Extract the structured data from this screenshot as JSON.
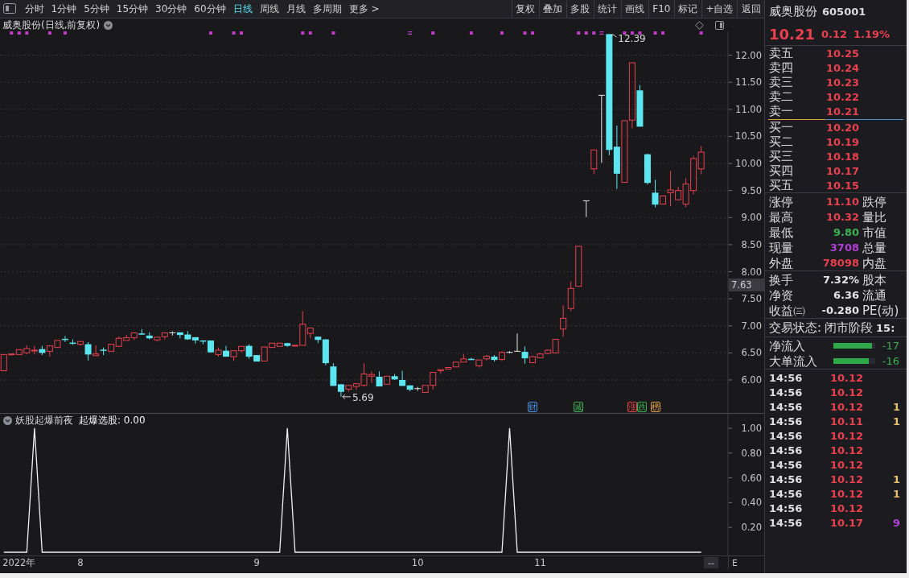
{
  "toolbar": {
    "period_tabs": [
      {
        "label": "分时",
        "selected": false
      },
      {
        "label": "1分钟",
        "selected": false
      },
      {
        "label": "5分钟",
        "selected": false
      },
      {
        "label": "15分钟",
        "selected": false
      },
      {
        "label": "30分钟",
        "selected": false
      },
      {
        "label": "60分钟",
        "selected": false
      },
      {
        "label": "日线",
        "selected": true
      },
      {
        "label": "周线",
        "selected": false
      },
      {
        "label": "月线",
        "selected": false
      },
      {
        "label": "多周期",
        "selected": false
      },
      {
        "label": "更多 >",
        "selected": false
      }
    ],
    "buttons": [
      "复权",
      "叠加",
      "多股",
      "统计",
      "画线",
      "F10",
      "标记",
      "+自选",
      "返回"
    ]
  },
  "chart_header": {
    "title": "威奥股份(日线,前复权)"
  },
  "main_chart": {
    "chart_data": [
      {
        "type": "candlestick",
        "ylim": [
          5.39,
          12.44
        ],
        "yticks": [
          {
            "value": 6,
            "label": "6.00"
          },
          {
            "value": 6.5,
            "label": "6.50"
          },
          {
            "value": 7,
            "label": "7.00"
          },
          {
            "value": 7.5,
            "label": "7.50"
          },
          {
            "value": 8,
            "label": "8.00"
          },
          {
            "value": 8.5,
            "label": "8.50"
          },
          {
            "value": 9,
            "label": "9.00"
          },
          {
            "value": 9.5,
            "label": "9.50"
          },
          {
            "value": 10,
            "label": "10.00"
          },
          {
            "value": 10.5,
            "label": "10.50"
          },
          {
            "value": 11,
            "label": "11.00"
          },
          {
            "value": 11.5,
            "label": "11.50"
          },
          {
            "value": 12,
            "label": "12.00"
          }
        ],
        "grid": true,
        "annotations": [
          "12.39",
          "5.69"
        ],
        "series": [
          {
            "type": "candlestick",
            "ohlc": [
              [
                6.17,
                6.47,
                6.17,
                6.47
              ],
              [
                6.47,
                6.49,
                6.46,
                6.48
              ],
              [
                6.47,
                6.56,
                6.47,
                6.56
              ],
              [
                6.5,
                6.64,
                6.47,
                6.58
              ],
              [
                6.54,
                6.63,
                6.47,
                6.55
              ],
              [
                6.57,
                6.63,
                6.46,
                6.5
              ],
              [
                6.53,
                6.63,
                6.43,
                6.63
              ],
              [
                6.6,
                6.73,
                6.6,
                6.73
              ],
              [
                6.76,
                6.81,
                6.7,
                6.75
              ],
              [
                6.69,
                6.75,
                6.65,
                6.68
              ],
              [
                6.66,
                6.71,
                6.63,
                6.71
              ],
              [
                6.66,
                6.7,
                6.36,
                6.47
              ],
              [
                6.45,
                6.64,
                6.44,
                6.48
              ],
              [
                6.56,
                6.6,
                6.46,
                6.55
              ],
              [
                6.53,
                6.66,
                6.53,
                6.66
              ],
              [
                6.62,
                6.8,
                6.62,
                6.77
              ],
              [
                6.73,
                6.83,
                6.73,
                6.78
              ],
              [
                6.78,
                6.87,
                6.74,
                6.87
              ],
              [
                6.86,
                6.94,
                6.83,
                6.85
              ],
              [
                6.82,
                6.88,
                6.75,
                6.77
              ],
              [
                6.74,
                6.79,
                6.71,
                6.79
              ],
              [
                6.8,
                6.87,
                6.75,
                6.87
              ],
              [
                6.87,
                6.9,
                6.82,
                6.87
              ],
              [
                6.88,
                6.88,
                6.77,
                6.83
              ],
              [
                6.84,
                6.9,
                6.74,
                6.75
              ],
              [
                6.79,
                6.79,
                6.67,
                6.73
              ],
              [
                6.73,
                6.73,
                6.66,
                6.72
              ],
              [
                6.73,
                6.73,
                6.51,
                6.51
              ],
              [
                6.47,
                6.6,
                6.43,
                6.55
              ],
              [
                6.54,
                6.63,
                6.43,
                6.43
              ],
              [
                6.43,
                6.54,
                6.35,
                6.54
              ],
              [
                6.54,
                6.62,
                6.51,
                6.62
              ],
              [
                6.63,
                6.66,
                6.39,
                6.43
              ],
              [
                6.46,
                6.46,
                6.34,
                6.34
              ],
              [
                6.35,
                6.61,
                6.35,
                6.61
              ],
              [
                6.6,
                6.68,
                6.6,
                6.68
              ],
              [
                6.62,
                6.68,
                6.62,
                6.68
              ],
              [
                6.68,
                6.68,
                6.61,
                6.63
              ],
              [
                6.63,
                6.64,
                6.63,
                6.64
              ],
              [
                6.64,
                7.27,
                6.64,
                7.03
              ],
              [
                6.86,
                6.96,
                6.77,
                6.96
              ],
              [
                6.8,
                6.8,
                6.68,
                6.74
              ],
              [
                6.75,
                6.75,
                6.27,
                6.31
              ],
              [
                6.25,
                6.31,
                5.89,
                5.89
              ],
              [
                5.92,
                5.92,
                5.69,
                5.78
              ],
              [
                5.83,
                5.9,
                5.78,
                5.9
              ],
              [
                5.88,
                5.93,
                5.82,
                5.93
              ],
              [
                5.9,
                6.31,
                5.88,
                6.11
              ],
              [
                6.07,
                6.16,
                5.94,
                6.1
              ],
              [
                6.06,
                6.16,
                5.88,
                5.88
              ],
              [
                5.92,
                6.07,
                5.92,
                6.07
              ],
              [
                6.07,
                6.11,
                6.0,
                6.01
              ],
              [
                6.0,
                6.17,
                5.89,
                5.89
              ],
              [
                5.9,
                5.9,
                5.79,
                5.82
              ],
              [
                5.84,
                5.87,
                5.8,
                5.84
              ],
              [
                5.77,
                5.9,
                5.77,
                5.9
              ],
              [
                5.9,
                6.14,
                5.82,
                6.14
              ],
              [
                6.17,
                6.19,
                6.12,
                6.19
              ],
              [
                6.2,
                6.23,
                6.2,
                6.23
              ],
              [
                6.24,
                6.33,
                6.24,
                6.33
              ],
              [
                6.33,
                6.48,
                6.33,
                6.39
              ],
              [
                6.39,
                6.41,
                6.37,
                6.38
              ],
              [
                6.26,
                6.37,
                6.23,
                6.37
              ],
              [
                6.39,
                6.46,
                6.36,
                6.44
              ],
              [
                6.43,
                6.46,
                6.34,
                6.37
              ],
              [
                6.38,
                6.53,
                6.35,
                6.51
              ],
              [
                6.51,
                6.53,
                6.49,
                6.51
              ],
              [
                6.53,
                6.86,
                6.52,
                6.53
              ],
              [
                6.52,
                6.62,
                6.3,
                6.4
              ],
              [
                6.32,
                6.45,
                6.31,
                6.43
              ],
              [
                6.41,
                6.5,
                6.4,
                6.48
              ],
              [
                6.49,
                6.56,
                6.48,
                6.55
              ],
              [
                6.5,
                6.76,
                6.49,
                6.75
              ],
              [
                6.94,
                7.38,
                6.8,
                7.14
              ],
              [
                7.32,
                7.82,
                7.27,
                7.69
              ],
              [
                7.73,
                8.47,
                7.73,
                8.47
              ],
              [
                9.31,
                9.31,
                9.01,
                9.31
              ],
              [
                9.9,
                10.25,
                9.8,
                10.25
              ],
              [
                11.26,
                11.26,
                10.01,
                11.26
              ],
              [
                12.39,
                12.39,
                10.15,
                10.25
              ],
              [
                10.31,
                10.7,
                9.53,
                9.81
              ],
              [
                9.65,
                10.79,
                9.65,
                10.79
              ],
              [
                10.8,
                11.86,
                10.65,
                11.86
              ],
              [
                11.35,
                11.45,
                10.68,
                10.68
              ],
              [
                10.17,
                10.18,
                9.61,
                9.64
              ],
              [
                9.46,
                9.7,
                9.19,
                9.24
              ],
              [
                9.25,
                9.41,
                9.24,
                9.4
              ],
              [
                9.46,
                9.86,
                9.21,
                9.51
              ],
              [
                9.33,
                9.57,
                9.32,
                9.5
              ],
              [
                9.25,
                9.73,
                9.19,
                9.62
              ],
              [
                9.5,
                10.14,
                9.43,
                10.09
              ],
              [
                9.9,
                10.32,
                9.8,
                10.21
              ],
              null,
              null,
              null
            ]
          },
          {
            "type": "scatter",
            "marker": "square",
            "color": "#c03cc8",
            "values": [
              null,
              12.41,
              12.41,
              12.41,
              null,
              null,
              12.41,
              null,
              12.41,
              null,
              null,
              null,
              null,
              null,
              null,
              null,
              null,
              null,
              null,
              null,
              null,
              null,
              null,
              null,
              null,
              null,
              null,
              12.41,
              null,
              null,
              12.41,
              12.41,
              null,
              null,
              null,
              null,
              null,
              null,
              null,
              12.41,
              12.41,
              null,
              null,
              12.41,
              null,
              null,
              null,
              null,
              null,
              null,
              null,
              null,
              null,
              null,
              null,
              null,
              12.41,
              null,
              null,
              null,
              null,
              12.41,
              null,
              null,
              null,
              12.41,
              null,
              null,
              12.41,
              12.41,
              null,
              null,
              null,
              null,
              null,
              12.41,
              12.41,
              12.41,
              null,
              null,
              null,
              12.41,
              12.41,
              12.41,
              null,
              12.41,
              12.41,
              null,
              null,
              null,
              null,
              12.41,
              null,
              null,
              null
            ]
          },
          {
            "type": "scatter",
            "color": "#c03cc8",
            "values": [
              null,
              null,
              null,
              null,
              null,
              null,
              null,
              null,
              null,
              null,
              null,
              null,
              null,
              null,
              null,
              null,
              null,
              null,
              null,
              null,
              null,
              null,
              null,
              null,
              null,
              null,
              null,
              null,
              null,
              null,
              null,
              null,
              null,
              null,
              null,
              null,
              null,
              null,
              null,
              null,
              null,
              null,
              null,
              null,
              null,
              null,
              null,
              null,
              null,
              null,
              null,
              null,
              null,
              12.41,
              null,
              null,
              null,
              null,
              null,
              null,
              null,
              null,
              null,
              null,
              null,
              null,
              null,
              null,
              null,
              null,
              null,
              null,
              null,
              null,
              null,
              null,
              null,
              null,
              12.41,
              null,
              null,
              null,
              null,
              null,
              null,
              null,
              null,
              null,
              null,
              null,
              null,
              null,
              null,
              null,
              null
            ]
          }
        ]
      }
    ],
    "cursor_price": "7.63",
    "event_tags": [
      {
        "label": "财",
        "color": "#4d8fe0"
      },
      {
        "label": "减",
        "color": "#3cb050"
      },
      {
        "label": "涨",
        "color": "#e04848"
      },
      {
        "label": "跌",
        "color": "#3cb050"
      },
      {
        "label": "榜",
        "color": "#e0a040"
      }
    ]
  },
  "indicator": {
    "name": "妖股起爆前夜",
    "reading": "起爆选股: 0.00",
    "chart_data": [
      {
        "type": "line",
        "color": "#f0f0f0",
        "ylim": [
          -0.026,
          1.123
        ],
        "yticks": [
          {
            "value": 0.2,
            "label": "0.20"
          },
          {
            "value": 0.4,
            "label": "0.40"
          },
          {
            "value": 0.6,
            "label": "0.60"
          },
          {
            "value": 0.8,
            "label": "0.80"
          },
          {
            "value": 1,
            "label": "1.00"
          }
        ],
        "categories": [
          null,
          null,
          "2022年",
          null,
          null,
          null,
          null,
          null,
          null,
          null,
          "8",
          null,
          null,
          null,
          null,
          null,
          null,
          null,
          null,
          null,
          null,
          null,
          null,
          null,
          null,
          null,
          null,
          null,
          null,
          null,
          null,
          null,
          null,
          "9",
          null,
          null,
          null,
          null,
          null,
          null,
          null,
          null,
          null,
          null,
          null,
          null,
          null,
          null,
          null,
          null,
          null,
          null,
          null,
          null,
          "10",
          null,
          null,
          null,
          null,
          null,
          null,
          null,
          null,
          null,
          null,
          null,
          null,
          null,
          null,
          null,
          "11",
          null,
          null,
          null,
          null,
          null,
          null,
          null,
          null,
          null,
          null,
          null,
          null,
          null,
          null,
          null,
          null,
          null,
          null,
          null,
          null,
          null,
          null,
          null,
          null
        ],
        "values": [
          0,
          0,
          0,
          0,
          1,
          0,
          0,
          0,
          0,
          0,
          0,
          0,
          0,
          0,
          0,
          0,
          0,
          0,
          0,
          0,
          0,
          0,
          0,
          0,
          0,
          0,
          0,
          0,
          0,
          0,
          0,
          0,
          0,
          0,
          0,
          0,
          0,
          1,
          0,
          0,
          0,
          0,
          0,
          0,
          0,
          0,
          0,
          0,
          0,
          0,
          0,
          0,
          0,
          0,
          0,
          0,
          0,
          0,
          0,
          0,
          0,
          0,
          0,
          0,
          0,
          0,
          1,
          0,
          0,
          0,
          0,
          0,
          0,
          0,
          0,
          0,
          0,
          0,
          0,
          0,
          0,
          0,
          0,
          0,
          0,
          0,
          0,
          0,
          0,
          0,
          0,
          0,
          null,
          null,
          null
        ]
      }
    ],
    "axis_buttons": [
      "--",
      "E"
    ]
  },
  "quote_panel": {
    "name": "威奥股份",
    "code": "605001",
    "price": "10.21",
    "change": "0.12",
    "change_pct": "1.19%",
    "asks": [
      {
        "label": "卖五",
        "price": "10.25"
      },
      {
        "label": "卖四",
        "price": "10.24"
      },
      {
        "label": "卖三",
        "price": "10.23"
      },
      {
        "label": "卖二",
        "price": "10.22"
      },
      {
        "label": "卖一",
        "price": "10.21"
      }
    ],
    "bids": [
      {
        "label": "买一",
        "price": "10.20"
      },
      {
        "label": "买二",
        "price": "10.19"
      },
      {
        "label": "买三",
        "price": "10.18"
      },
      {
        "label": "买四",
        "price": "10.17"
      },
      {
        "label": "买五",
        "price": "10.15"
      }
    ],
    "stats": [
      {
        "label": "涨停",
        "value": "11.10",
        "color": "#e8404e",
        "label_2": "跌停"
      },
      {
        "label": "最高",
        "value": "10.32",
        "color": "#e8404e",
        "label_2": "量比"
      },
      {
        "label": "最低",
        "value": "9.80",
        "color": "#3cb050",
        "label_2": "市值"
      },
      {
        "label": "现量",
        "value": "3708",
        "color": "#b040d8",
        "label_2": "总量"
      },
      {
        "label": "外盘",
        "value": "78098",
        "color": "#e8404e",
        "label_2": "内盘"
      }
    ],
    "stats_2": [
      {
        "label": "换手",
        "value": "7.32%",
        "label_2": "股本"
      },
      {
        "label": "净资",
        "value": "6.36",
        "label_2": "流通"
      },
      {
        "label": "收益㈢",
        "value": "-0.280",
        "label_2": "PE(动)"
      }
    ],
    "status": {
      "label": "交易状态:",
      "value": "闭市阶段",
      "time": "15:"
    },
    "flows": [
      {
        "label": "净流入",
        "level": 0.92,
        "value": "-17"
      },
      {
        "label": "大单流入",
        "level": 0.85,
        "value": "-16"
      }
    ],
    "ticks": [
      {
        "time": "14:56",
        "price": "10.12"
      },
      {
        "time": "14:56",
        "price": "10.12"
      },
      {
        "time": "14:56",
        "price": "10.12",
        "volume": "1",
        "color": "#e8c070"
      },
      {
        "time": "14:56",
        "price": "10.11",
        "volume": "1",
        "color": "#e8c070"
      },
      {
        "time": "14:56",
        "price": "10.12"
      },
      {
        "time": "14:56",
        "price": "10.12"
      },
      {
        "time": "14:56",
        "price": "10.12"
      },
      {
        "time": "14:56",
        "price": "10.12",
        "volume": "1",
        "color": "#e8c070"
      },
      {
        "time": "14:56",
        "price": "10.12",
        "volume": "1",
        "color": "#e8c070"
      },
      {
        "time": "14:56",
        "price": "10.12"
      },
      {
        "time": "14:56",
        "price": "10.17",
        "volume": "9",
        "color": "#b040d8"
      }
    ]
  }
}
